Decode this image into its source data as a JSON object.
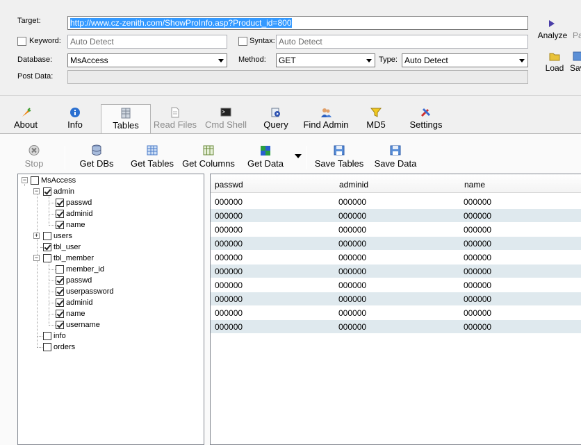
{
  "target": {
    "label": "Target:",
    "url": "http://www.cz-zenith.com/ShowProInfo.asp?Product_id=800"
  },
  "keyword": {
    "label": "Keyword:",
    "placeholder": "Auto Detect",
    "checked": false
  },
  "syntax": {
    "label": "Syntax:",
    "placeholder": "Auto Detect",
    "checked": false
  },
  "database": {
    "label": "Database:",
    "value": "MsAccess"
  },
  "method": {
    "label": "Method:",
    "value": "GET"
  },
  "type": {
    "label": "Type:",
    "value": "Auto Detect"
  },
  "post_data": {
    "label": "Post Data:"
  },
  "side_buttons": {
    "analyze": "Analyze",
    "analyze_cut": "Pa",
    "load": "Load",
    "save_cut": "Sav"
  },
  "tabs": {
    "about": "About",
    "info": "Info",
    "tables": "Tables",
    "read_files": "Read Files",
    "cmd_shell": "Cmd Shell",
    "query": "Query",
    "find_admin": "Find Admin",
    "md5": "MD5",
    "settings": "Settings"
  },
  "toolbar": {
    "stop": "Stop",
    "get_dbs": "Get DBs",
    "get_tables": "Get Tables",
    "get_columns": "Get Columns",
    "get_data": "Get Data",
    "save_tables": "Save Tables",
    "save_data": "Save Data"
  },
  "tree": {
    "root": "MsAccess",
    "admin": "admin",
    "admin_passwd": "passwd",
    "admin_adminid": "adminid",
    "admin_name": "name",
    "users": "users",
    "tbl_user": "tbl_user",
    "tbl_member": "tbl_member",
    "member_id": "member_id",
    "member_passwd": "passwd",
    "member_userpassword": "userpassword",
    "member_adminid": "adminid",
    "member_name": "name",
    "member_username": "username",
    "info": "info",
    "orders": "orders"
  },
  "grid": {
    "columns": [
      "passwd",
      "adminid",
      "name"
    ],
    "rows": [
      [
        "000000",
        "000000",
        "000000"
      ],
      [
        "000000",
        "000000",
        "000000"
      ],
      [
        "000000",
        "000000",
        "000000"
      ],
      [
        "000000",
        "000000",
        "000000"
      ],
      [
        "000000",
        "000000",
        "000000"
      ],
      [
        "000000",
        "000000",
        "000000"
      ],
      [
        "000000",
        "000000",
        "000000"
      ],
      [
        "000000",
        "000000",
        "000000"
      ],
      [
        "000000",
        "000000",
        "000000"
      ],
      [
        "000000",
        "000000",
        "000000"
      ]
    ]
  },
  "colors": {
    "selection": "#3399ff",
    "row_alt": "#dfe9ee",
    "accent": "#2a6fbf"
  }
}
